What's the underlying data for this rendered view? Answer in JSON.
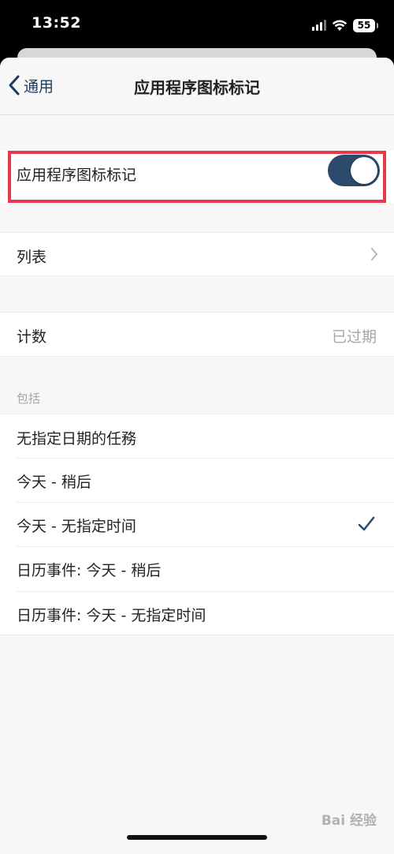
{
  "status_bar": {
    "time": "13:52",
    "battery_level": "55",
    "signal_icon": "cellular-signal-icon",
    "wifi_icon": "wifi-icon"
  },
  "nav": {
    "back_label": "通用",
    "title": "应用程序图标标记"
  },
  "badge_toggle": {
    "label": "应用程序图标标记",
    "on": true
  },
  "list_row": {
    "label": "列表"
  },
  "count_row": {
    "label": "计数",
    "value": "已过期"
  },
  "include_section": {
    "header": "包括",
    "items": [
      {
        "label": "无指定日期的任務",
        "checked": false
      },
      {
        "label": "今天 - 稍后",
        "checked": false
      },
      {
        "label": "今天 - 无指定时间",
        "checked": true
      },
      {
        "label": "日历事件: 今天 - 稍后",
        "checked": false
      },
      {
        "label": "日历事件: 今天 - 无指定时间",
        "checked": false
      }
    ]
  },
  "watermark": "Bai 经验",
  "colors": {
    "accent": "#2c4a6b",
    "highlight_border": "#e8394b",
    "background": "#f7f7f7"
  }
}
